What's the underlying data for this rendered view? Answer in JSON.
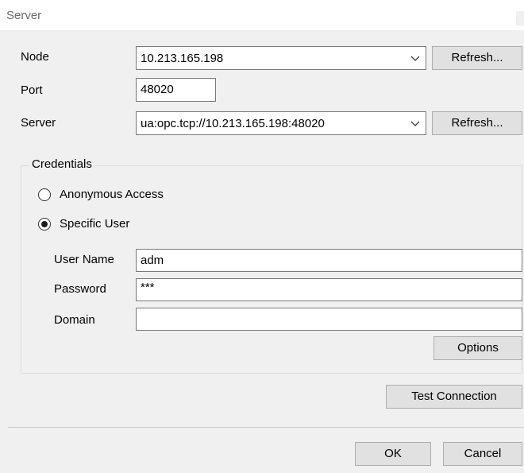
{
  "window": {
    "title": "Server"
  },
  "connection": {
    "node_label": "Node",
    "node_value": "10.213.165.198",
    "node_refresh": "Refresh...",
    "port_label": "Port",
    "port_value": "48020",
    "server_label": "Server",
    "server_value": "ua:opc.tcp://10.213.165.198:48020",
    "server_refresh": "Refresh..."
  },
  "credentials": {
    "legend": "Credentials",
    "anonymous_label": "Anonymous Access",
    "specific_label": "Specific User",
    "selected": "Specific User",
    "username_label": "User Name",
    "username_value": "adm",
    "password_label": "Password",
    "password_value": "***",
    "domain_label": "Domain",
    "domain_value": "",
    "options_label": "Options"
  },
  "actions": {
    "test_connection": "Test Connection",
    "ok": "OK",
    "cancel": "Cancel"
  },
  "icons": {
    "dropdown": "chevron-down-icon"
  },
  "colors": {
    "dialog_bg": "#f0f0f0",
    "button_bg": "#e1e1e1",
    "border": "#7a7a7a"
  }
}
